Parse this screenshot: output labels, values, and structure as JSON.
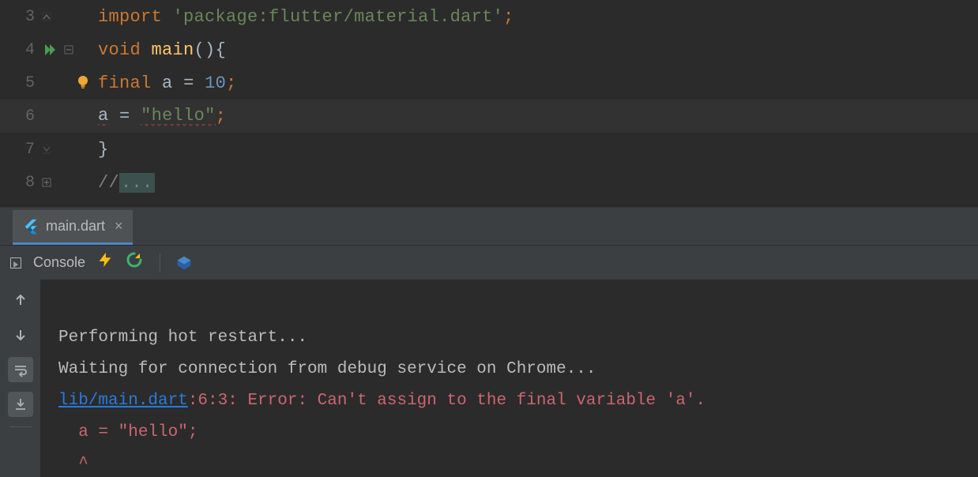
{
  "editor": {
    "lines": [
      {
        "n": "3",
        "tokens": {
          "kw": "import",
          "str": "'package:flutter/material.dart'",
          "sc": ";"
        }
      },
      {
        "n": "4",
        "tokens": {
          "kw": "void",
          "id": "main",
          "par": "()",
          "br": "{"
        }
      },
      {
        "n": "5",
        "tokens": {
          "kw": "final",
          "id": "a",
          "eq": "=",
          "num": "10",
          "sc": ";"
        }
      },
      {
        "n": "6",
        "tokens": {
          "id": "a",
          "eq": "=",
          "str": "\"hello\"",
          "sc": ";"
        }
      },
      {
        "n": "7",
        "tokens": {
          "br": "}"
        }
      },
      {
        "n": "8",
        "tokens": {
          "cmt": "//",
          "folded": "..."
        }
      }
    ]
  },
  "tab": {
    "label": "main.dart",
    "close": "×"
  },
  "console": {
    "title": "Console",
    "line1": "Performing hot restart...",
    "line2": "Waiting for connection from debug service on Chrome...",
    "err_link": "lib/main.dart",
    "err_rest": ":6:3: Error: Can't assign to the final variable 'a'.",
    "err_code": "  a = \"hello\";",
    "err_caret": "  ^"
  }
}
